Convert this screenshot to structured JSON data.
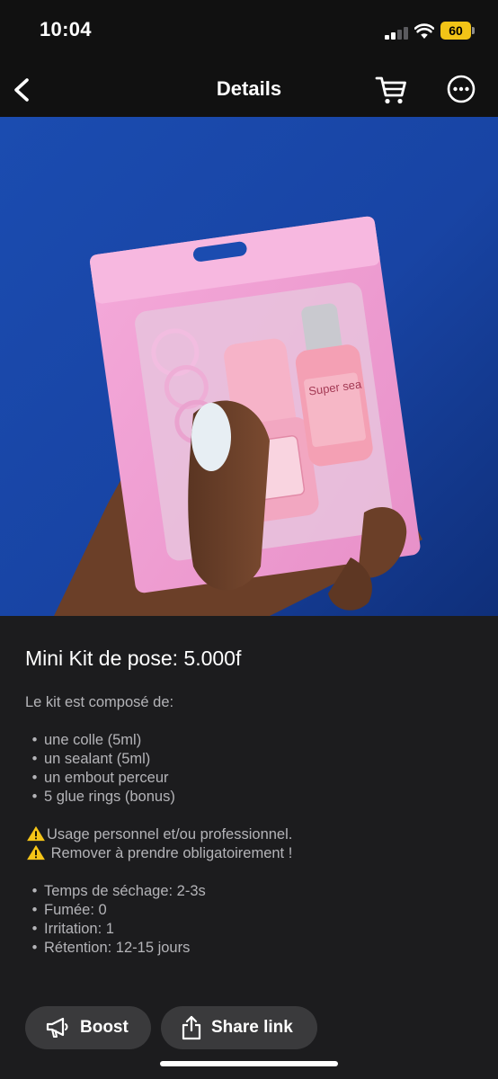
{
  "status": {
    "time": "10:04",
    "battery": "60"
  },
  "nav": {
    "title": "Details"
  },
  "product": {
    "title": "Mini Kit de pose: 5.000f",
    "intro": "Le kit est composé de:",
    "contents": [
      "une colle (5ml)",
      "un sealant (5ml)",
      "un embout perceur",
      "5 glue rings (bonus)"
    ],
    "warnings": [
      "Usage personnel et/ou professionnel.",
      " Remover à prendre obligatoirement !"
    ],
    "specs": [
      "Temps de séchage: 2-3s",
      "Fumée: 0",
      "Irritation: 1",
      "Rétention: 12-15 jours"
    ],
    "bottle_label": "Super sea",
    "image": {
      "description_icon": "product-photo",
      "bag_color": "#f2a6d6",
      "background_color": "#1a44a8"
    }
  },
  "actions": {
    "boost": "Boost",
    "share": "Share link"
  },
  "colors": {
    "background": "#1c1c1e",
    "button": "#3a3a3c",
    "battery": "#f2c417",
    "warning": "#f5c518"
  }
}
